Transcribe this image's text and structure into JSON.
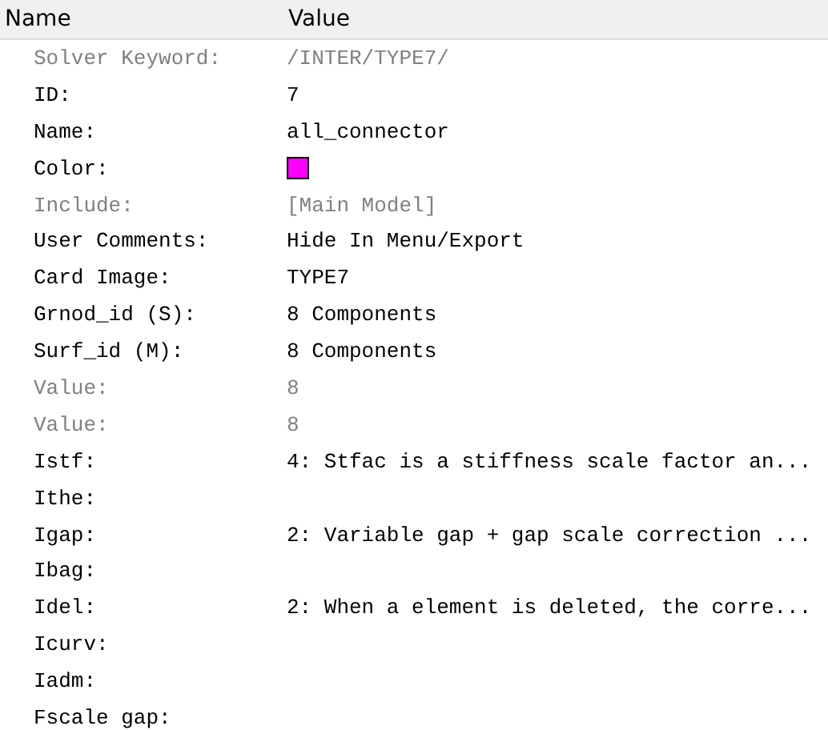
{
  "table": {
    "columns": [
      "Name",
      "Value"
    ],
    "rows": [
      {
        "name": "Solver Keyword:",
        "kind": "text",
        "value": "/INTER/TYPE7/",
        "disabled": true
      },
      {
        "name": "ID:",
        "kind": "text",
        "value": "7",
        "disabled": false
      },
      {
        "name": "Name:",
        "kind": "text",
        "value": "all_connector",
        "disabled": false
      },
      {
        "name": "Color:",
        "kind": "color",
        "color": "#ff00ff",
        "disabled": false
      },
      {
        "name": "Include:",
        "kind": "text",
        "value": "[Main Model]",
        "disabled": true
      },
      {
        "name": "User Comments:",
        "kind": "text",
        "value": "Hide In Menu/Export",
        "disabled": false
      },
      {
        "name": "Card Image:",
        "kind": "text",
        "value": "TYPE7",
        "disabled": false
      },
      {
        "name": "Grnod_id (S):",
        "kind": "text",
        "value": "8 Components",
        "disabled": false
      },
      {
        "name": "Surf_id (M):",
        "kind": "text",
        "value": "8 Components",
        "disabled": false
      },
      {
        "name": "Value:",
        "kind": "text",
        "value": "8",
        "disabled": true
      },
      {
        "name": "Value:",
        "kind": "text",
        "value": "8",
        "disabled": true
      },
      {
        "name": "Istf:",
        "kind": "text",
        "value": "4: Stfac is a stiffness scale factor an...",
        "disabled": false
      },
      {
        "name": "Ithe:",
        "kind": "text",
        "disabled": false
      },
      {
        "name": "Igap:",
        "kind": "text",
        "value": "2: Variable gap + gap scale correction ...",
        "disabled": false
      },
      {
        "name": "Ibag:",
        "kind": "text",
        "disabled": false
      },
      {
        "name": "Idel:",
        "kind": "text",
        "value": "2: When a element is deleted, the corre...",
        "disabled": false
      },
      {
        "name": "Icurv:",
        "kind": "text",
        "disabled": false
      },
      {
        "name": "Iadm:",
        "kind": "text",
        "disabled": false
      },
      {
        "name": "Fscale gap:",
        "kind": "text",
        "disabled": false
      }
    ]
  }
}
